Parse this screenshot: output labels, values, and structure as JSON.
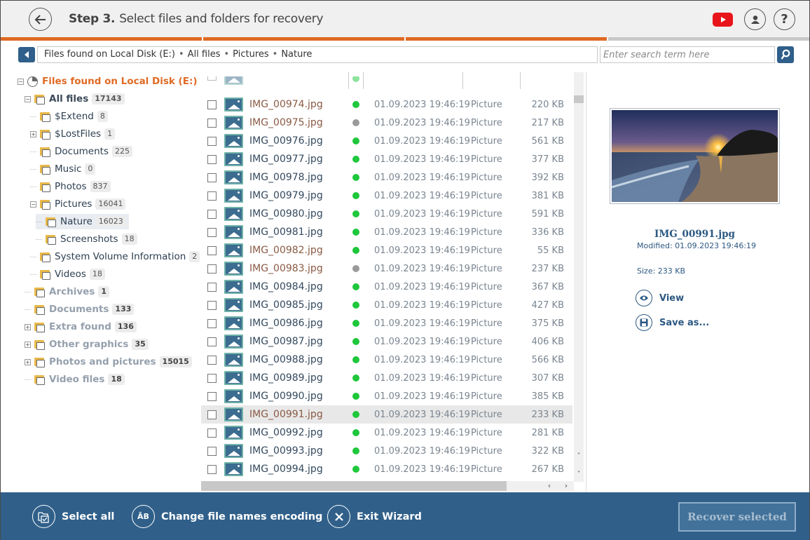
{
  "header": {
    "step_label": "Step 3.",
    "title": "Select files and folders for recovery",
    "progress": {
      "completed_steps": 3,
      "total_steps": 4
    }
  },
  "path": {
    "segments": [
      "Files found on Local Disk (E:)",
      "All files",
      "Pictures",
      "Nature"
    ],
    "separator": "•"
  },
  "search": {
    "placeholder": "Enter search term here",
    "value": ""
  },
  "tree": {
    "root": {
      "label": "Files found on Local Disk (E:)"
    },
    "nodes": [
      {
        "label": "All files",
        "count": "17143",
        "expander": "minus"
      },
      {
        "label": "$Extend",
        "count": "8",
        "expander": "none"
      },
      {
        "label": "$LostFiles",
        "count": "1",
        "expander": "plus"
      },
      {
        "label": "Documents",
        "count": "225",
        "expander": "none"
      },
      {
        "label": "Music",
        "count": "0",
        "expander": "none"
      },
      {
        "label": "Photos",
        "count": "837",
        "expander": "none"
      },
      {
        "label": "Pictures",
        "count": "16041",
        "expander": "minus"
      },
      {
        "label": "Nature",
        "count": "16023",
        "expander": "none",
        "selected": true
      },
      {
        "label": "Screenshots",
        "count": "18",
        "expander": "none"
      },
      {
        "label": "System Volume Information",
        "count": "2",
        "expander": "none"
      },
      {
        "label": "Videos",
        "count": "18",
        "expander": "none"
      },
      {
        "label": "Archives",
        "count": "1",
        "expander": "none"
      },
      {
        "label": "Documents",
        "count": "133",
        "expander": "none"
      },
      {
        "label": "Extra found",
        "count": "136",
        "expander": "plus"
      },
      {
        "label": "Other graphics",
        "count": "35",
        "expander": "plus"
      },
      {
        "label": "Photos and pictures",
        "count": "15015",
        "expander": "plus"
      },
      {
        "label": "Video files",
        "count": "18",
        "expander": "none"
      }
    ]
  },
  "files": {
    "rows": [
      {
        "name": "IMG_00974.jpg",
        "status": "good",
        "deleted": true,
        "modified": "01.09.2023 19:46:19",
        "type": "Picture",
        "size": "220 KB"
      },
      {
        "name": "IMG_00975.jpg",
        "status": "unknown",
        "deleted": true,
        "modified": "01.09.2023 19:46:19",
        "type": "Picture",
        "size": "217 KB"
      },
      {
        "name": "IMG_00976.jpg",
        "status": "good",
        "deleted": false,
        "modified": "01.09.2023 19:46:19",
        "type": "Picture",
        "size": "561 KB"
      },
      {
        "name": "IMG_00977.jpg",
        "status": "good",
        "deleted": false,
        "modified": "01.09.2023 19:46:19",
        "type": "Picture",
        "size": "377 KB"
      },
      {
        "name": "IMG_00978.jpg",
        "status": "good",
        "deleted": false,
        "modified": "01.09.2023 19:46:19",
        "type": "Picture",
        "size": "392 KB"
      },
      {
        "name": "IMG_00979.jpg",
        "status": "good",
        "deleted": false,
        "modified": "01.09.2023 19:46:19",
        "type": "Picture",
        "size": "381 KB"
      },
      {
        "name": "IMG_00980.jpg",
        "status": "good",
        "deleted": false,
        "modified": "01.09.2023 19:46:19",
        "type": "Picture",
        "size": "591 KB"
      },
      {
        "name": "IMG_00981.jpg",
        "status": "good",
        "deleted": false,
        "modified": "01.09.2023 19:46:19",
        "type": "Picture",
        "size": "336 KB"
      },
      {
        "name": "IMG_00982.jpg",
        "status": "good",
        "deleted": true,
        "modified": "01.09.2023 19:46:19",
        "type": "Picture",
        "size": "55 KB"
      },
      {
        "name": "IMG_00983.jpg",
        "status": "unknown",
        "deleted": true,
        "modified": "01.09.2023 19:46:19",
        "type": "Picture",
        "size": "237 KB"
      },
      {
        "name": "IMG_00984.jpg",
        "status": "good",
        "deleted": false,
        "modified": "01.09.2023 19:46:19",
        "type": "Picture",
        "size": "367 KB"
      },
      {
        "name": "IMG_00985.jpg",
        "status": "good",
        "deleted": false,
        "modified": "01.09.2023 19:46:19",
        "type": "Picture",
        "size": "427 KB"
      },
      {
        "name": "IMG_00986.jpg",
        "status": "good",
        "deleted": false,
        "modified": "01.09.2023 19:46:19",
        "type": "Picture",
        "size": "375 KB"
      },
      {
        "name": "IMG_00987.jpg",
        "status": "good",
        "deleted": false,
        "modified": "01.09.2023 19:46:19",
        "type": "Picture",
        "size": "406 KB"
      },
      {
        "name": "IMG_00988.jpg",
        "status": "good",
        "deleted": false,
        "modified": "01.09.2023 19:46:19",
        "type": "Picture",
        "size": "566 KB"
      },
      {
        "name": "IMG_00989.jpg",
        "status": "good",
        "deleted": false,
        "modified": "01.09.2023 19:46:19",
        "type": "Picture",
        "size": "307 KB"
      },
      {
        "name": "IMG_00990.jpg",
        "status": "good",
        "deleted": false,
        "modified": "01.09.2023 19:46:19",
        "type": "Picture",
        "size": "385 KB"
      },
      {
        "name": "IMG_00991.jpg",
        "status": "good",
        "deleted": true,
        "modified": "01.09.2023 19:46:19",
        "type": "Picture",
        "size": "233 KB",
        "selected": true
      },
      {
        "name": "IMG_00992.jpg",
        "status": "good",
        "deleted": false,
        "modified": "01.09.2023 19:46:19",
        "type": "Picture",
        "size": "281 KB"
      },
      {
        "name": "IMG_00993.jpg",
        "status": "good",
        "deleted": false,
        "modified": "01.09.2023 19:46:19",
        "type": "Picture",
        "size": "322 KB"
      },
      {
        "name": "IMG_00994.jpg",
        "status": "good",
        "deleted": false,
        "modified": "01.09.2023 19:46:19",
        "type": "Picture",
        "size": "267 KB"
      }
    ],
    "status_colors": {
      "good": "#1ec73b",
      "unknown": "#9a9a9a"
    }
  },
  "preview": {
    "file_name": "IMG_00991.jpg",
    "modified": "Modified: 01.09.2023 19:46:19",
    "size": "Size: 233 KB",
    "view_label": "View",
    "save_label": "Save as..."
  },
  "footer": {
    "select_all": "Select all",
    "encoding": "Change file names encoding",
    "encoding_icon_text": "ĀB",
    "exit": "Exit Wizard",
    "recover": "Recover selected"
  },
  "colors": {
    "accent": "#e06a24",
    "brand_blue": "#30608a"
  }
}
